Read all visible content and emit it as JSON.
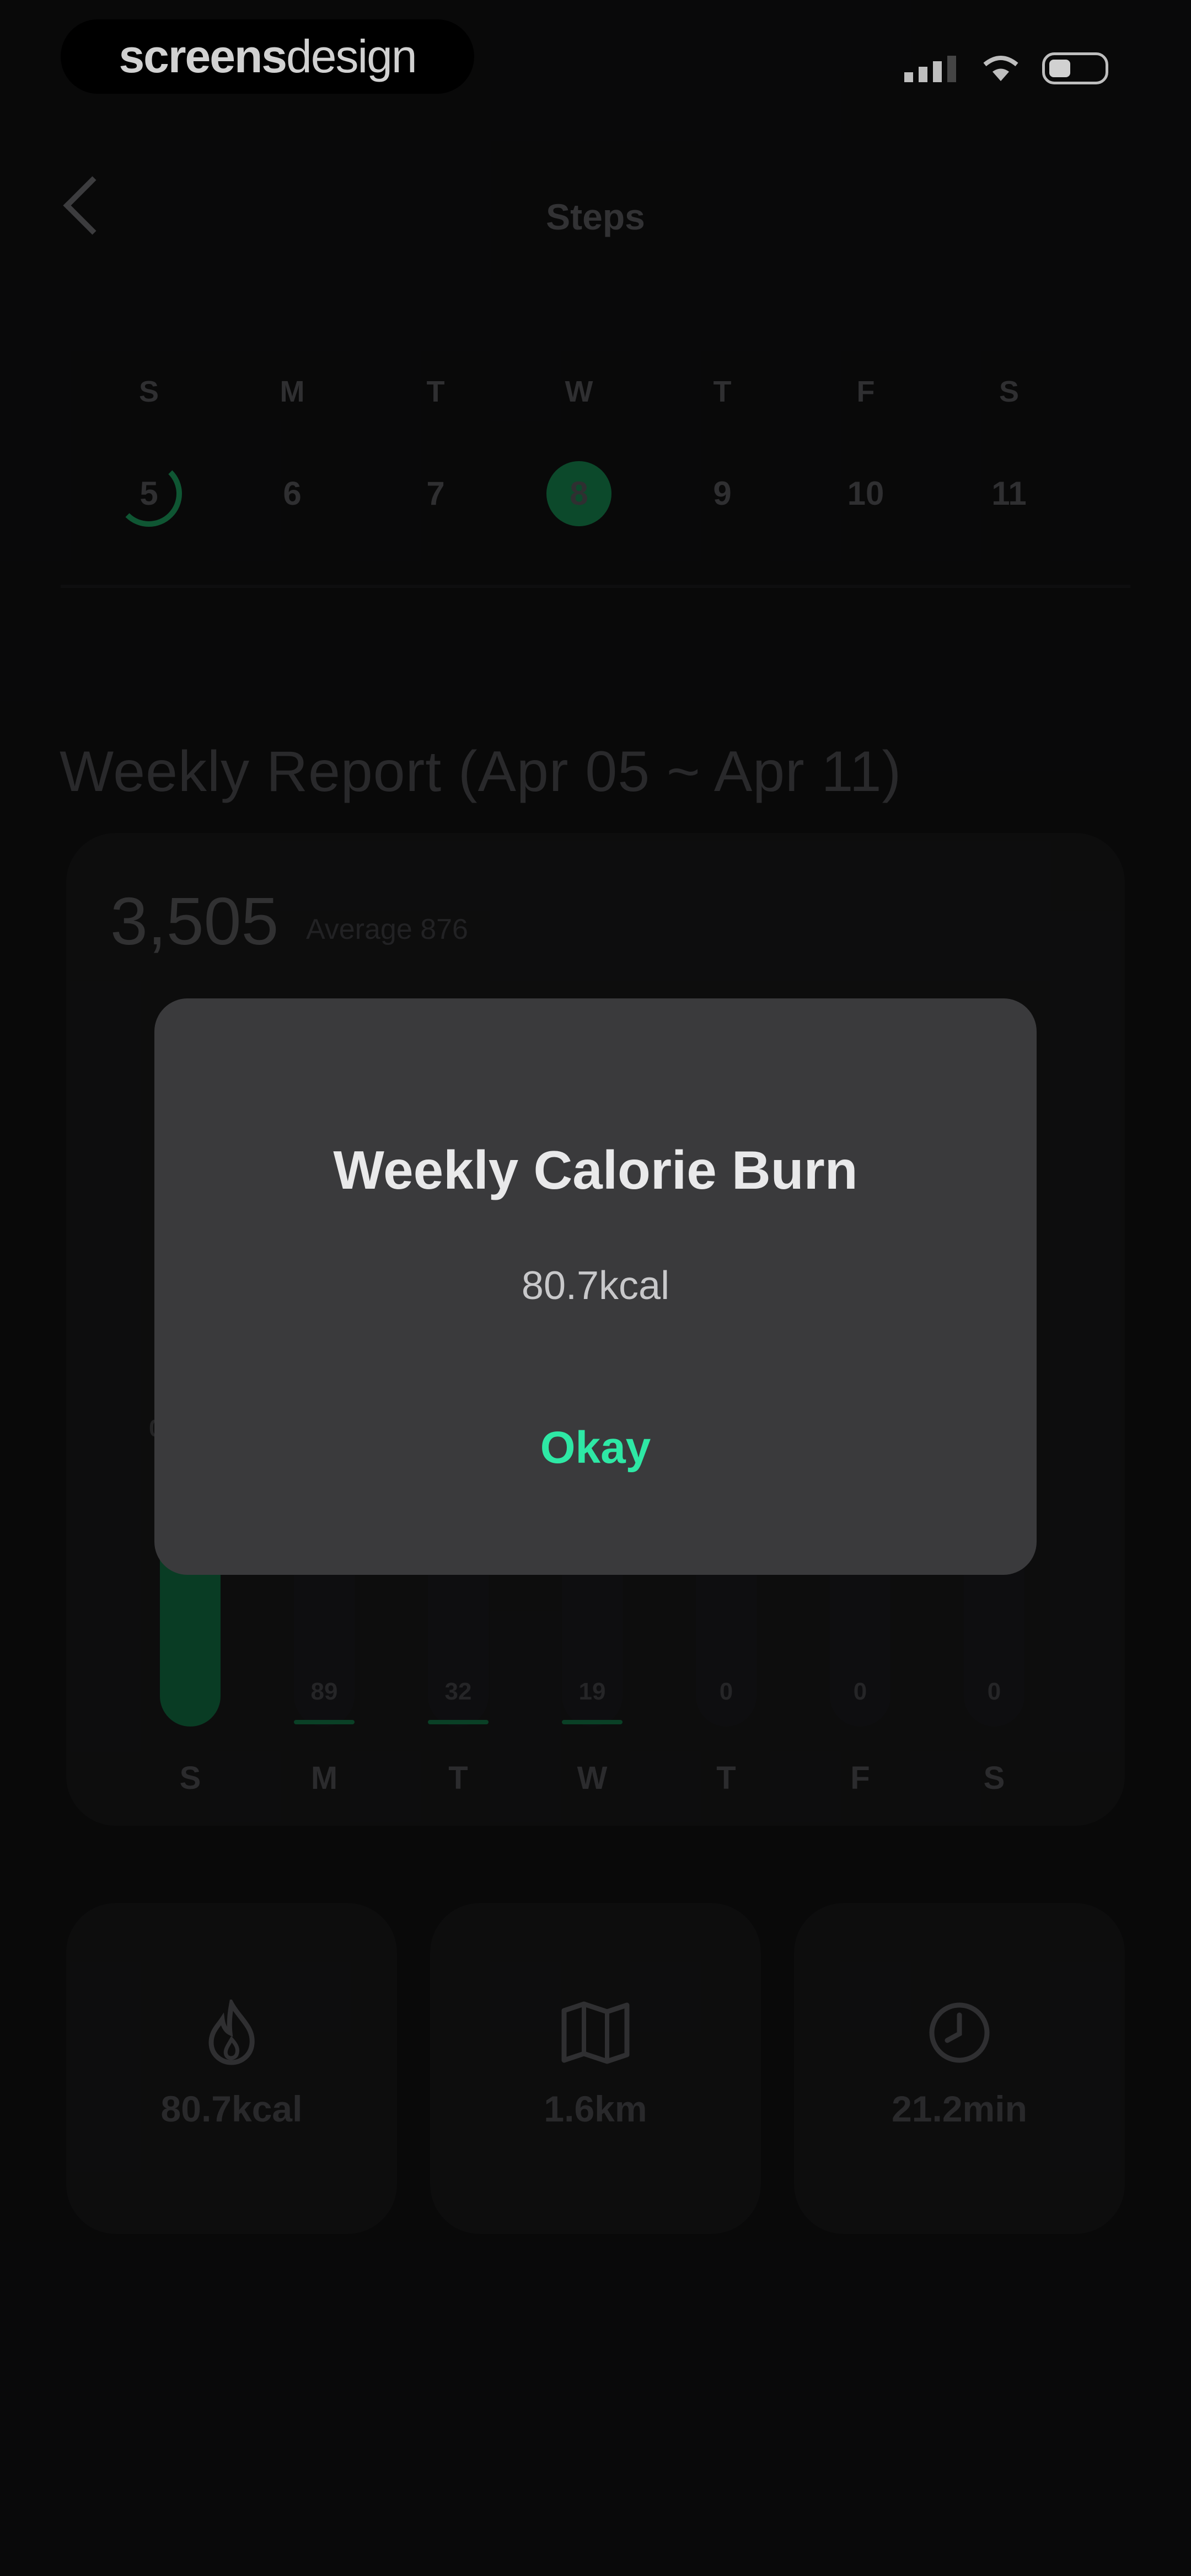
{
  "status_bar": {
    "brand_bold": "screens",
    "brand_light": "design"
  },
  "header": {
    "title": "Steps"
  },
  "week_strip": {
    "days": [
      {
        "letter": "S",
        "date": "5"
      },
      {
        "letter": "M",
        "date": "6"
      },
      {
        "letter": "T",
        "date": "7"
      },
      {
        "letter": "W",
        "date": "8"
      },
      {
        "letter": "T",
        "date": "9"
      },
      {
        "letter": "F",
        "date": "10"
      },
      {
        "letter": "S",
        "date": "11"
      }
    ],
    "selected_index": 3,
    "progress_ring_index": 0
  },
  "report": {
    "title": "Weekly Report (Apr 05 ~ Apr 11)",
    "total": "3,505",
    "average": "Average 876",
    "axis_label": "0k",
    "colors": {
      "accent": "#2ee8a5",
      "bar": "#0c4a2c"
    }
  },
  "chart_data": {
    "type": "bar",
    "categories": [
      "S",
      "M",
      "T",
      "W",
      "T",
      "F",
      "S"
    ],
    "values": [
      3305,
      89,
      32,
      19,
      0,
      0,
      0
    ],
    "value_labels": [
      "",
      "89",
      "32",
      "19",
      "0",
      "0",
      "0"
    ]
  },
  "stats": [
    {
      "icon": "flame-icon",
      "value": "80.7kcal"
    },
    {
      "icon": "map-icon",
      "value": "1.6km"
    },
    {
      "icon": "clock-icon",
      "value": "21.2min"
    }
  ],
  "dialog": {
    "title": "Weekly Calorie Burn",
    "message": "80.7kcal",
    "button": "Okay"
  }
}
